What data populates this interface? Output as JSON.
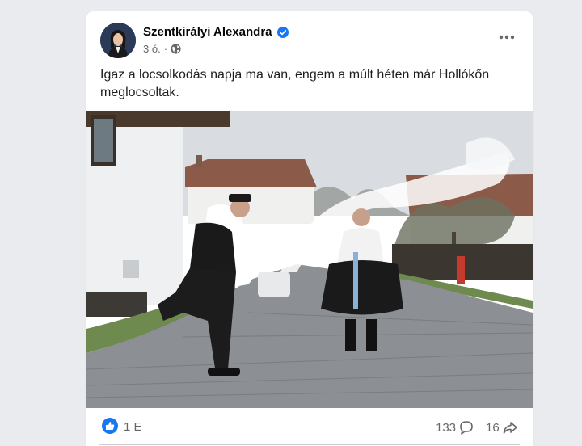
{
  "post": {
    "author": "Szentkirályi Alexandra",
    "verified": true,
    "time": "3 ó.",
    "separator": "·",
    "audience_icon": "globe-icon",
    "text_line1": "Igaz a locsolkodás napja ma van, engem a múlt héten már Hollókőn",
    "text_line2": "meglocsoltak.",
    "photo_description_icon": "photo"
  },
  "stats": {
    "reactions": "1 E",
    "comments": "133",
    "shares": "16"
  },
  "colors": {
    "page_bg": "#e9ebee",
    "card_bg": "#ffffff",
    "accent": "#1877f2",
    "secondary_text": "#65676b"
  }
}
